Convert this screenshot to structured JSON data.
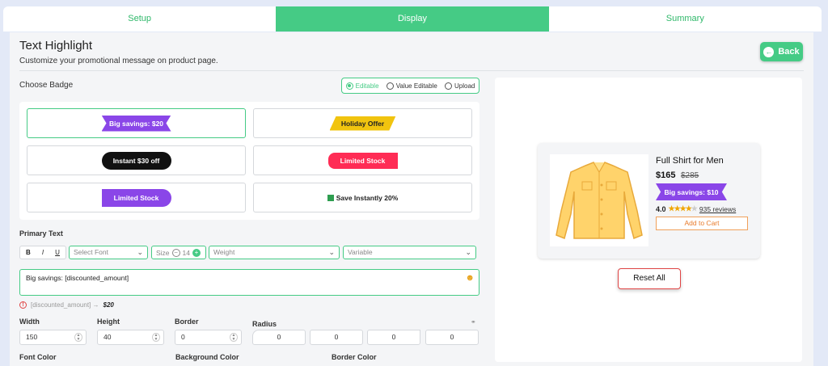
{
  "tabs": [
    {
      "label": "Setup"
    },
    {
      "label": "Display"
    },
    {
      "label": "Summary"
    }
  ],
  "header": {
    "title": "Text Highlight",
    "subtitle": "Customize your promotional message on product page.",
    "back_label": "Back"
  },
  "badges": {
    "label": "Choose Badge",
    "options": [
      {
        "label": "Editable"
      },
      {
        "label": "Value Editable"
      },
      {
        "label": "Upload"
      }
    ],
    "items": [
      {
        "text": "Big savings: $20"
      },
      {
        "text": "Holiday Offer"
      },
      {
        "text": "Instant $30 off"
      },
      {
        "text": "Limited Stock"
      },
      {
        "text": "Limited Stock"
      },
      {
        "text": "Save Instantly 20%"
      }
    ]
  },
  "primary": {
    "label": "Primary Text",
    "bold": "B",
    "italic": "I",
    "underline": "U",
    "font_placeholder": "Select Font",
    "size_label": "Size",
    "size_value": "14",
    "weight_placeholder": "Weight",
    "variable_placeholder": "Variable",
    "text_value": "Big savings: [discounted_amount]",
    "hint_var": "[discounted_amount] →",
    "hint_val": "$20"
  },
  "dims": {
    "width_label": "Width",
    "width_value": "150",
    "height_label": "Height",
    "height_value": "40",
    "border_label": "Border",
    "border_value": "0",
    "radius_label": "Radius",
    "radius_values": [
      "0",
      "0",
      "0",
      "0"
    ]
  },
  "colors": {
    "font_label": "Font Color",
    "bg_label": "Background Color",
    "border_label": "Border Color"
  },
  "preview": {
    "product_name": "Full Shirt for Men",
    "price": "$165",
    "old_price": "$285",
    "badge_text": "Big savings: $10",
    "rating": "4.0",
    "reviews": "935 reviews",
    "add_to_cart": "Add to Cart",
    "reset_label": "Reset All"
  },
  "theme": {
    "accent": "#45cb85",
    "badge_purple": "#8a46e8",
    "badge_yellow": "#f1c40f",
    "badge_red": "#ff2c55"
  }
}
